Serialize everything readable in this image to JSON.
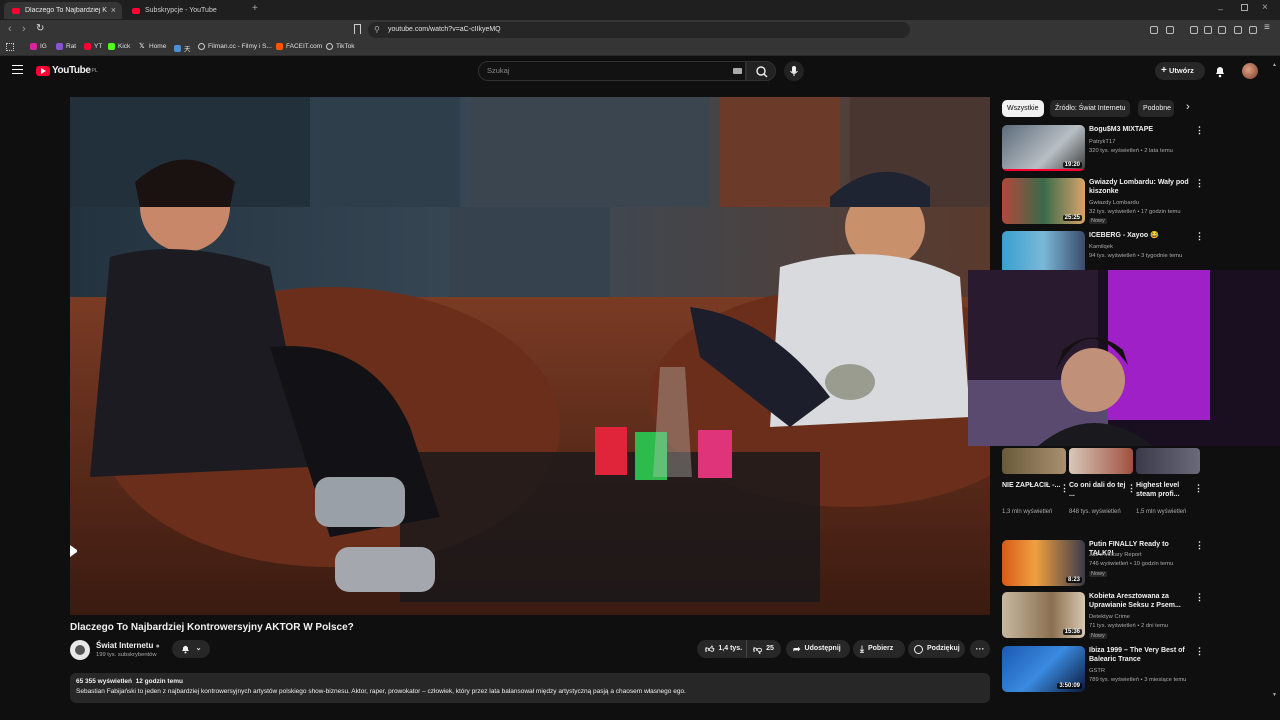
{
  "browser": {
    "tabs": [
      {
        "label": "Dlaczego To Najbardziej Kon",
        "active": true
      },
      {
        "label": "Subskrypcje - YouTube",
        "active": false
      }
    ],
    "url": "youtube.com/watch?v=aC-cIIkyeMQ",
    "bookmarks": [
      "IG",
      "Rat",
      "YT",
      "Kick",
      "Home",
      "天",
      "Filman.cc - Filmy i S...",
      "FACEIT.com",
      "TikTok"
    ]
  },
  "youtube": {
    "logo": "YouTube",
    "logo_region": "PL",
    "search_placeholder": "Szukaj",
    "create_label": "Utwórz",
    "accent": "#ff0033"
  },
  "video": {
    "title": "Dlaczego To Najbardziej Kontrowersyjny AKTOR W Polsce?",
    "channel": "Świat Internetu",
    "subscribers": "199 tys. subskrybentów",
    "likes": "1,4 tys.",
    "dislikes": "25",
    "share": "Udostępnij",
    "download": "Pobierz",
    "thanks": "Podziękuj",
    "views": "65 355 wyświetleń",
    "age": "12 godzin temu",
    "description": "Sebastian Fabijański to jeden z najbardziej kontrowersyjnych artystów polskiego show-biznesu. Aktor, raper, prowokator – człowiek, który przez lata balansował między artystyczną pasją a chaosem własnego ego."
  },
  "chips": [
    "Wszystkie",
    "Źródło: Świat Internetu",
    "Podobne"
  ],
  "recommendations": [
    {
      "title": "Bogu$M3 MIXTAPE",
      "channel": "PatrykT17",
      "meta": "320 tys. wyświetleń • 2 lata temu",
      "duration": "19:20",
      "new": ""
    },
    {
      "title": "Gwiazdy Lombardu: Wały pod kiszonke",
      "channel": "Gwiazdy Lombardu",
      "meta": "32 tys. wyświetleń • 17 godzin temu",
      "duration": "25:25",
      "new": "Nowy"
    },
    {
      "title": "ICEBERG - Xayoo 😂",
      "channel": "Kamilqek",
      "meta": "94 tys. wyświetleń • 3 tygodnie temu",
      "duration": "",
      "new": ""
    },
    {
      "title": "Putin FINALLY Ready to TALK?!",
      "channel": "J&J's Military Report",
      "meta": "746 wyświetleń • 10 godzin temu",
      "duration": "8:23",
      "new": "Nowy"
    },
    {
      "title": "Kobieta Aresztowana za Uprawianie Seksu z Psem...",
      "channel": "Detektyw Crime",
      "meta": "71 tys. wyświetleń • 2 dni temu",
      "duration": "15:36",
      "new": "Nowy"
    },
    {
      "title": "Ibiza 1999 – The Very Best of Balearic Trance",
      "channel": "GSTR",
      "meta": "789 tys. wyświetleń • 3 miesiące temu",
      "duration": "3:50:09",
      "new": ""
    }
  ],
  "shorts": [
    {
      "title": "NIE ZAPŁACIŁ -...",
      "views": "1,3 mln wyświetleń"
    },
    {
      "title": "Co oni dali do tej ...",
      "views": "848 tys. wyświetleń"
    },
    {
      "title": "Highest level steam profi...",
      "views": "1,5 mln wyświetleń"
    }
  ]
}
